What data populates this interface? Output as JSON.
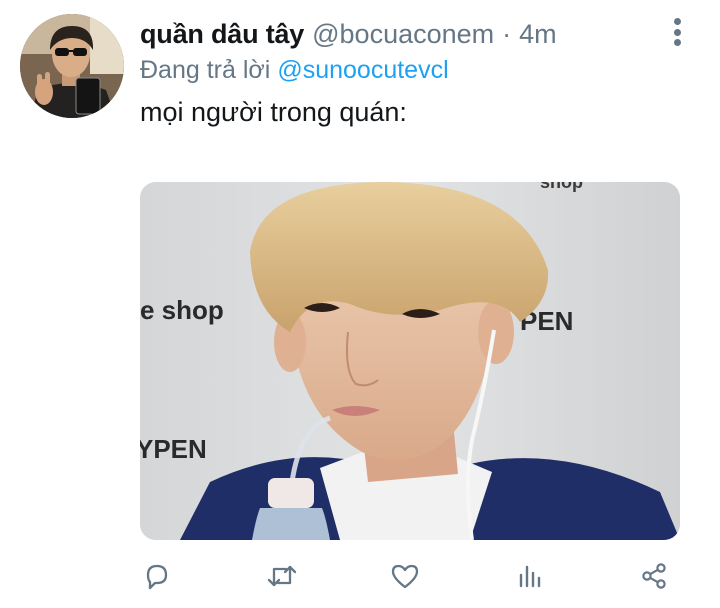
{
  "tweet": {
    "author": {
      "display_name": "quần dâu tây",
      "handle": "@bocuaconem",
      "separator": "·",
      "time": "4m"
    },
    "reply": {
      "prefix": "Đang trả lời",
      "mention": "@sunoocutevcl"
    },
    "text": "mọi người trong quán:",
    "media": {
      "sign_texts": [
        "e shop",
        "YPEN",
        "PEN",
        "shop"
      ]
    }
  },
  "actions": {
    "icons": [
      "reply-icon",
      "retweet-icon",
      "like-icon",
      "analytics-icon",
      "share-icon"
    ]
  },
  "colors": {
    "text": "#14171a",
    "muted": "#657786",
    "link": "#1da1f2",
    "icon": "#657786"
  }
}
